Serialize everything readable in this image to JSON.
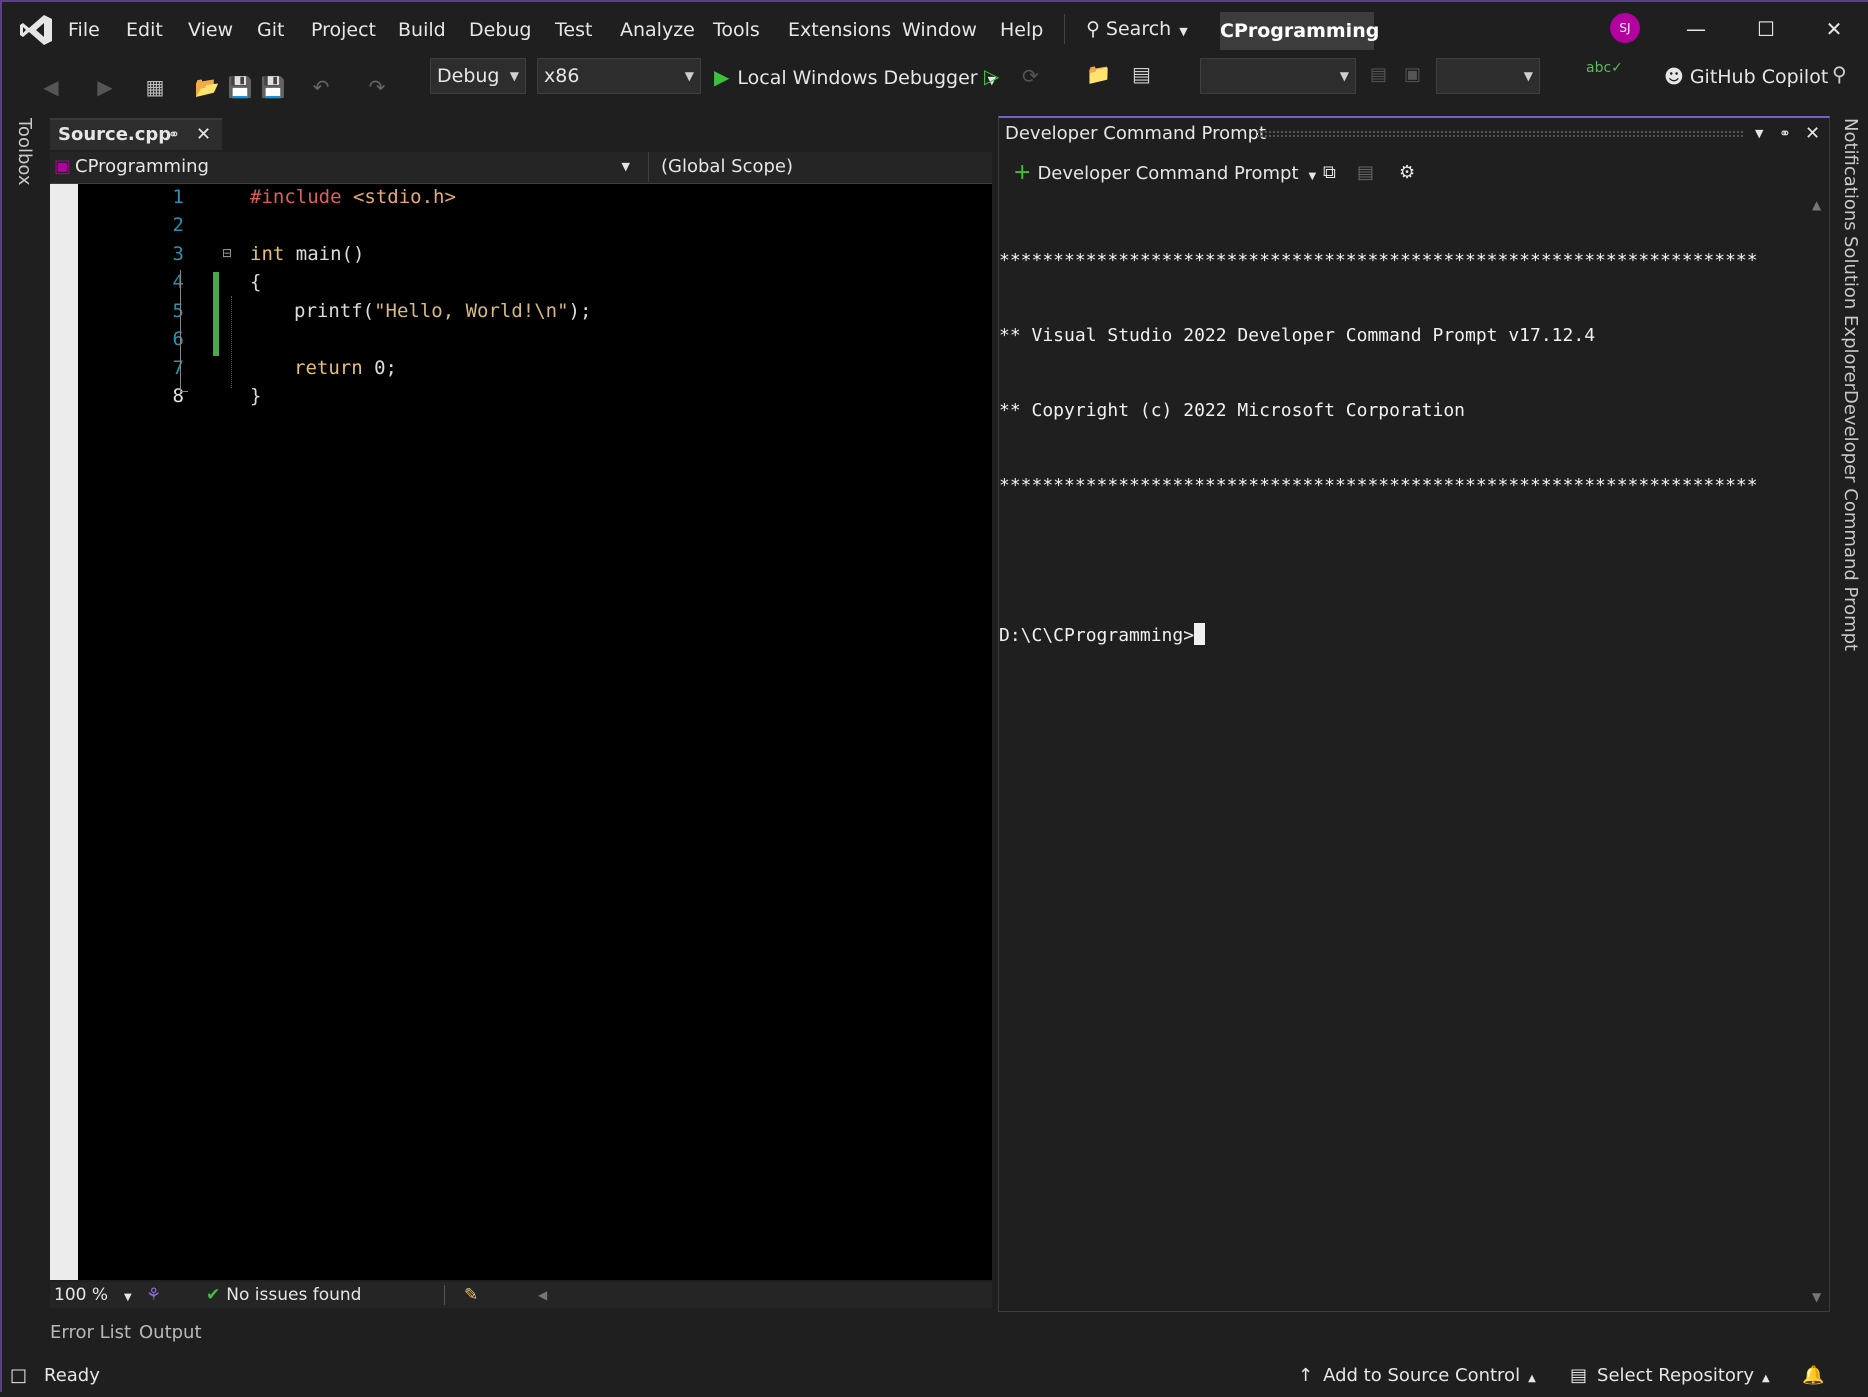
{
  "menubar": {
    "items": [
      "File",
      "Edit",
      "View",
      "Git",
      "Project",
      "Build",
      "Debug",
      "Test",
      "Analyze",
      "Tools",
      "Extensions",
      "Window",
      "Help"
    ],
    "search_label": "Search",
    "solution_name": "CProgramming",
    "avatar_initials": "SJ"
  },
  "toolbar": {
    "config": "Debug",
    "platform": "x86",
    "debugger_label": "Local Windows Debugger",
    "copilot_label": "GitHub Copilot"
  },
  "side": {
    "left_label": "Toolbox",
    "right_labels": [
      "Notifications",
      "Solution Explorer",
      "Developer Command Prompt"
    ]
  },
  "editor": {
    "tab_label": "Source.cpp",
    "nav_project": "CProgramming",
    "nav_scope": "(Global Scope)",
    "line_numbers": [
      "1",
      "2",
      "3",
      "4",
      "5",
      "6",
      "7",
      "8"
    ],
    "zoom": "100 %",
    "issues": "No issues found"
  },
  "code": {
    "l1_pre": "#include",
    "l1_inc": " <stdio.h>",
    "l3_kw": "int",
    "l3_rest": " main()",
    "l4": "{",
    "l5_fn": "printf(",
    "l5_str": "\"Hello, World!\\n\"",
    "l5_end": ");",
    "l7_kw": "return",
    "l7_rest": " 0;",
    "l8": "}"
  },
  "bottom_tabs": [
    "Error List",
    "Output"
  ],
  "terminal": {
    "title": "Developer Command Prompt",
    "tab_label": "Developer Command Prompt",
    "lines": [
      "**********************************************************************",
      "** Visual Studio 2022 Developer Command Prompt v17.12.4",
      "** Copyright (c) 2022 Microsoft Corporation",
      "**********************************************************************",
      "",
      "D:\\C\\CProgramming>"
    ]
  },
  "statusbar": {
    "ready": "Ready",
    "source_control": "Add to Source Control",
    "repository": "Select Repository"
  },
  "colors": {
    "accent": "#7d5cc8",
    "change_bar": "#4ca64c",
    "line_number": "#2b91af",
    "avatar": "#b4009e"
  }
}
